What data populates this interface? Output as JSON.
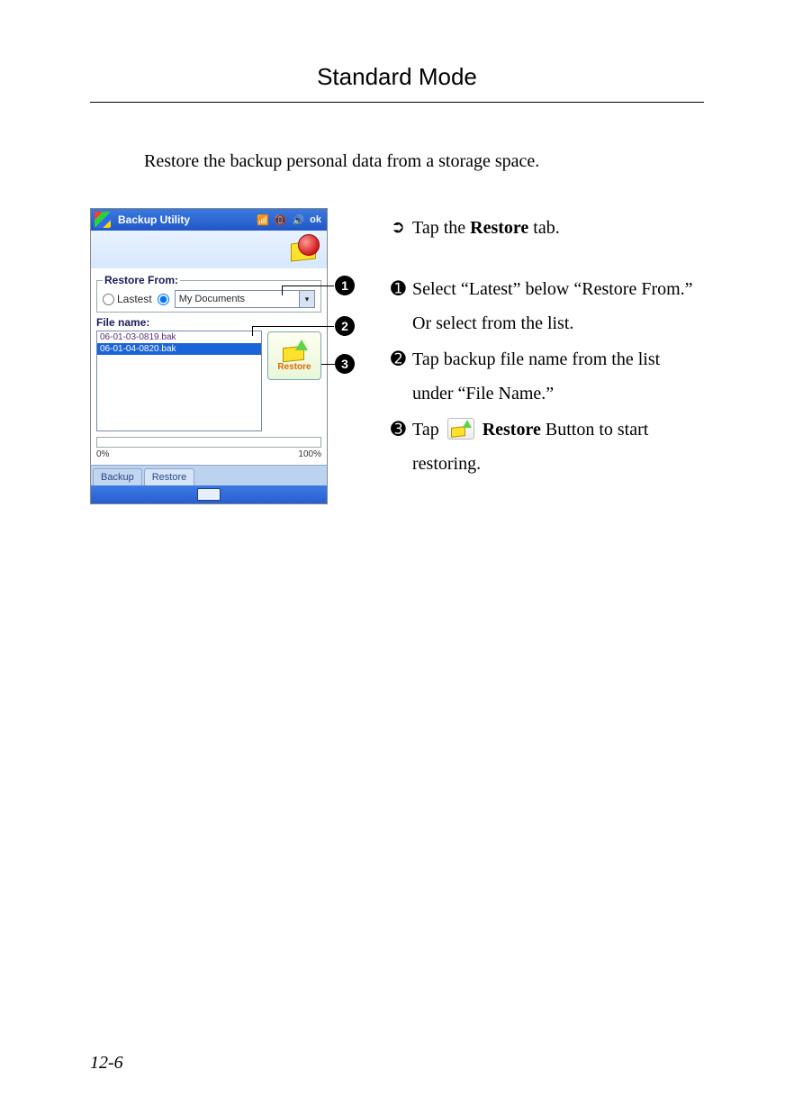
{
  "header": {
    "title": "Standard Mode"
  },
  "intro": "Restore the backup personal data from a storage space.",
  "page_number": "12-6",
  "pda": {
    "titlebar": {
      "title": "Backup Utility",
      "tray": [
        "📶",
        "📵",
        "🔊",
        "ok"
      ]
    },
    "restore_from": {
      "legend": "Restore From:",
      "radio_latest": "Lastest",
      "combo_value": "My Documents"
    },
    "file_list": {
      "label": "File name:",
      "items": [
        "06-01-03-0819.bak",
        "06-01-04-0820.bak"
      ],
      "selected_index": 1
    },
    "restore_button": "Restore",
    "progress": {
      "left": "0%",
      "right": "100%"
    },
    "tabs": {
      "backup": "Backup",
      "restore": "Restore"
    }
  },
  "callouts": {
    "m1": "1",
    "m2": "2",
    "m3": "3"
  },
  "instructions": {
    "c_sym": "➲",
    "c_pre": "Tap the ",
    "c_bold": "Restore",
    "c_post": " tab.",
    "n1_sym": "➊",
    "n1": "Select “Latest” below “Restore From.” Or select from the list.",
    "n2_sym": "➋",
    "n2": "Tap backup file name from the list under “File Name.”",
    "n3_sym": "➌",
    "n3_pre": "Tap ",
    "n3_bold": "Restore",
    "n3_post": " Button to start restoring."
  }
}
